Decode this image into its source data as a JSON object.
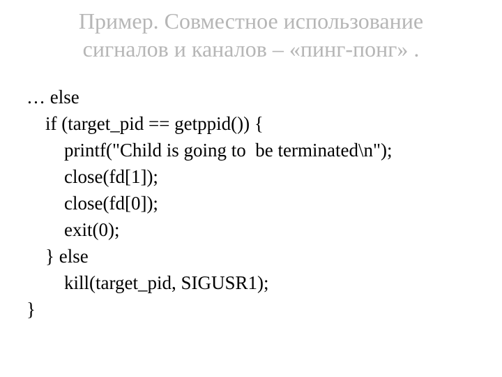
{
  "title": "Пример. Совместное использование\nсигналов и каналов – «пинг-понг» .",
  "code": "… else\n    if (target_pid == getppid()) {\n        printf(\"Child is going to  be terminated\\n\");\n        close(fd[1]);\n        close(fd[0]);\n        exit(0);\n    } else\n        kill(target_pid, SIGUSR1);\n}"
}
